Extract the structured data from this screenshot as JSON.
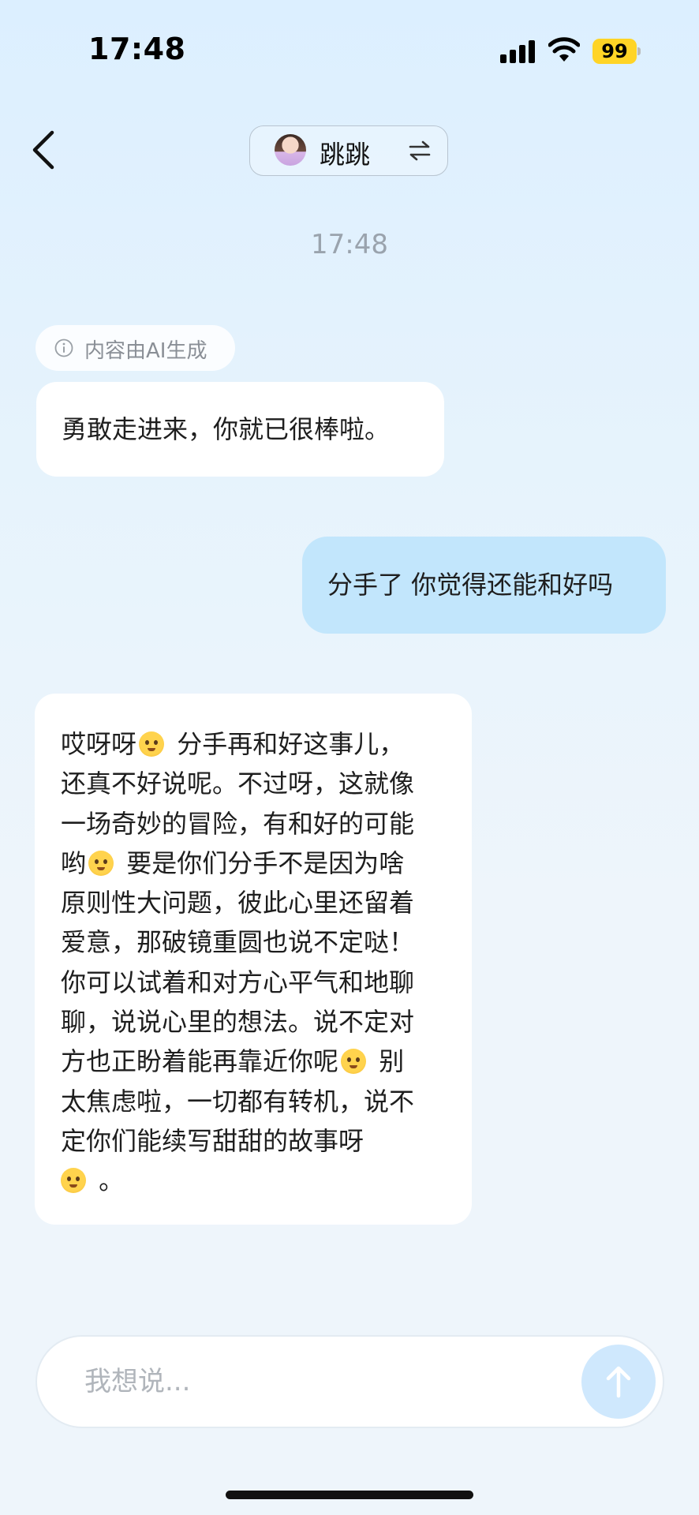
{
  "status_bar": {
    "time": "17:48",
    "battery": "99"
  },
  "header": {
    "name": "跳跳"
  },
  "timestamp": "17:48",
  "ai_notice": "内容由AI生成",
  "messages": {
    "bot_1": "勇敢走进来，你就已很棒啦。",
    "user_1": "分手了 你觉得还能和好吗",
    "bot_2_lines": [
      "哎呀呀",
      "分手再和好这事儿，",
      "还真不好说呢。不过呀，这就像",
      "一场奇妙的冒险，有和好的可能",
      "哟",
      "要是你们分手不是因为啥",
      "原则性大问题，彼此心里还留着",
      "爱意，那破镜重圆也说不定哒！",
      "你可以试着和对方心平气和地聊",
      "聊，说说心里的想法。说不定对",
      "方也正盼着能再靠近你呢",
      "别",
      "太焦虑啦，一切都有转机，说不",
      "定你们能续写甜甜的故事呀",
      "。"
    ]
  },
  "input": {
    "placeholder": "我想说..."
  },
  "icons": {
    "back": "back-chevron-icon",
    "swap": "swap-arrows-icon",
    "info": "info-icon",
    "send": "send-arrow-icon"
  },
  "colors": {
    "user_bubble": "#c2e6fc",
    "send_button": "#cfe8fd",
    "battery": "#ffd426"
  }
}
